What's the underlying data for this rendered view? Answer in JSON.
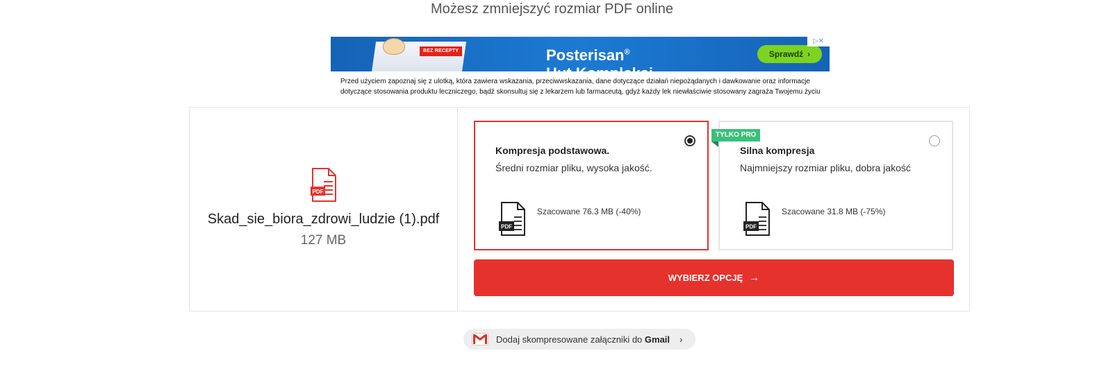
{
  "header": {
    "subtitle": "Możesz zmniejszyć rozmiar PDF online"
  },
  "ad": {
    "tag": "BEZ RECEPTY",
    "brand": "Posterisan",
    "brand_mark": "®",
    "brand_sub": "Hut Kompleksi",
    "cta": "Sprawdź",
    "choices": "▷✕",
    "disclaimer": "Przed użyciem zapoznaj się z ulotką, która zawiera wskazania, przeciwwskazania, dane dotyczące działań niepożądanych i dawkowanie oraz informacje dotyczące stosowania produktu leczniczego, bądź skonsultuj się z lekarzem lub farmaceutą, gdyż każdy lek niewłaściwie stosowany zagraża Twojemu życiu lub zdrowiu."
  },
  "file": {
    "icon": "pdf-file-icon",
    "name": "Skad_sie_biora_zdrowi_ludzie (1).pdf",
    "size": "127 MB"
  },
  "options": [
    {
      "title": "Kompresja podstawowa.",
      "description": "Średni rozmiar pliku, wysoka jakość.",
      "estimate": "Szacowane 76.3 MB (-40%)",
      "selected": true
    },
    {
      "badge": "TYLKO PRO",
      "title": "Silna kompresja",
      "description": "Najmniejszy rozmiar pliku, dobra jakość",
      "estimate": "Szacowane 31.8 MB (-75%)",
      "selected": false
    }
  ],
  "action": {
    "label": "WYBIERZ OPCJĘ",
    "arrow": "→"
  },
  "gmail": {
    "text": "Dodaj skompresowane załączniki do",
    "brand": "Gmail",
    "chevron": "›"
  },
  "colors": {
    "accent": "#e5322d",
    "pro_badge": "#3bc07b",
    "ad_blue": "#1a6fc4",
    "ad_cta": "#7ed321"
  }
}
